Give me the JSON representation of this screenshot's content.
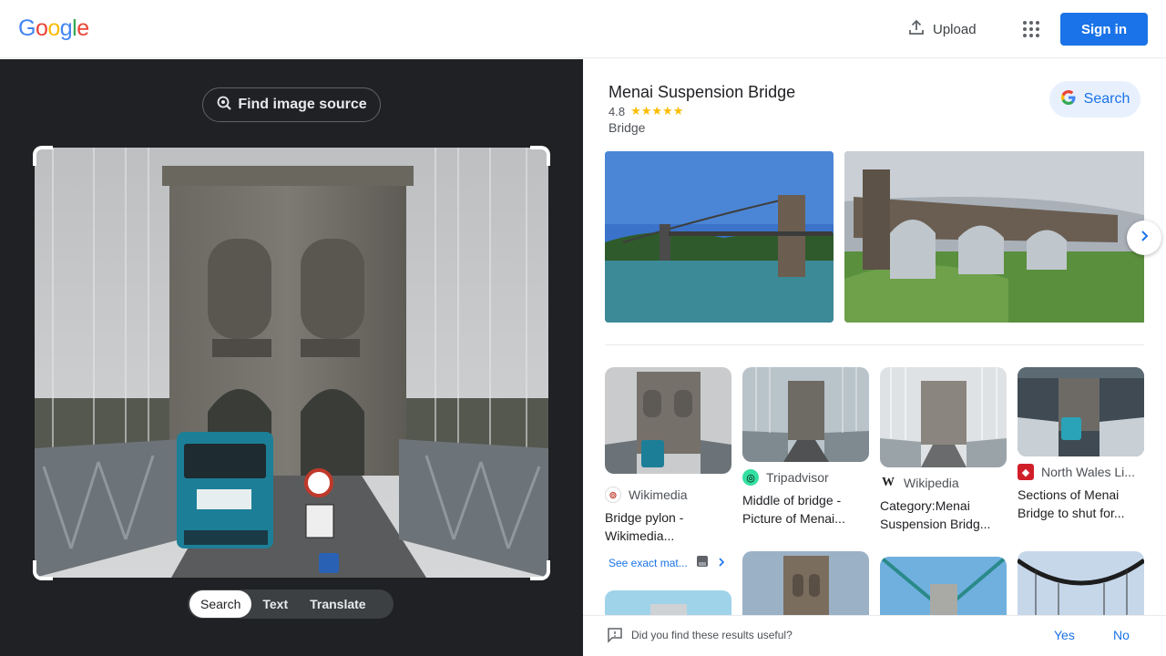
{
  "header": {
    "logo": [
      "G",
      "o",
      "o",
      "g",
      "l",
      "e"
    ],
    "upload_label": "Upload",
    "signin_label": "Sign in"
  },
  "colors": {
    "google_blue": "#4285F4",
    "google_red": "#EA4335",
    "google_yellow": "#FBBC05",
    "google_green": "#34A853",
    "primary": "#1a73e8",
    "dark_bg": "#202124"
  },
  "left_panel": {
    "find_source_label": "Find image source",
    "modes": [
      {
        "label": "Search",
        "active": true
      },
      {
        "label": "Text",
        "active": false
      },
      {
        "label": "Translate",
        "active": false
      }
    ]
  },
  "knowledge_panel": {
    "title": "Menai Suspension Bridge",
    "rating": "4.8",
    "stars": "★★★★★",
    "type": "Bridge",
    "search_label": "Search"
  },
  "results": [
    {
      "source": "Wikimedia",
      "title": "Bridge pylon - Wikimedia...",
      "icon": "wikimedia-icon"
    },
    {
      "source": "Tripadvisor",
      "title": "Middle of bridge - Picture of Menai...",
      "icon": "tripadvisor-icon"
    },
    {
      "source": "Wikipedia",
      "title": "Category:Menai Suspension Bridg...",
      "icon": "wikipedia-icon"
    },
    {
      "source": "North Wales Li...",
      "title": "Sections of Menai Bridge to shut for...",
      "icon": "north-wales-icon"
    }
  ],
  "exact_matches_label": "See exact mat...",
  "feedback": {
    "question": "Did you find these results useful?",
    "yes": "Yes",
    "no": "No"
  }
}
